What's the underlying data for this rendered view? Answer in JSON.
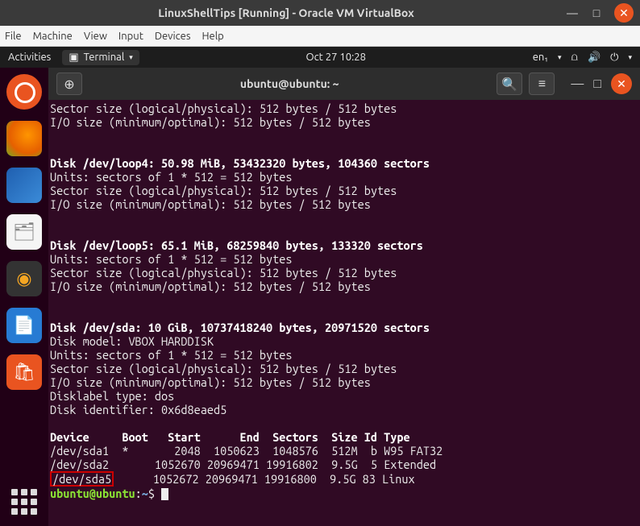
{
  "vbox": {
    "title": "LinuxShellTips [Running] - Oracle VM VirtualBox",
    "menu": {
      "file": "File",
      "machine": "Machine",
      "view": "View",
      "input": "Input",
      "devices": "Devices",
      "help": "Help"
    }
  },
  "gnome": {
    "activities": "Activities",
    "app_label": "Terminal",
    "datetime": "Oct 27  10:28",
    "lang": "en₁"
  },
  "terminal": {
    "title": "ubuntu@ubuntu: ~",
    "prompt_user": "ubuntu@ubuntu",
    "prompt_path": "~",
    "prompt_symbol": "$",
    "intro_lines": [
      "Sector size (logical/physical): 512 bytes / 512 bytes",
      "I/O size (minimum/optimal): 512 bytes / 512 bytes"
    ],
    "loop4": {
      "header": "Disk /dev/loop4: 50.98 MiB, 53432320 bytes, 104360 sectors",
      "lines": [
        "Units: sectors of 1 * 512 = 512 bytes",
        "Sector size (logical/physical): 512 bytes / 512 bytes",
        "I/O size (minimum/optimal): 512 bytes / 512 bytes"
      ]
    },
    "loop5": {
      "header": "Disk /dev/loop5: 65.1 MiB, 68259840 bytes, 133320 sectors",
      "lines": [
        "Units: sectors of 1 * 512 = 512 bytes",
        "Sector size (logical/physical): 512 bytes / 512 bytes",
        "I/O size (minimum/optimal): 512 bytes / 512 bytes"
      ]
    },
    "sda": {
      "header": "Disk /dev/sda: 10 GiB, 10737418240 bytes, 20971520 sectors",
      "lines": [
        "Disk model: VBOX HARDDISK   ",
        "Units: sectors of 1 * 512 = 512 bytes",
        "Sector size (logical/physical): 512 bytes / 512 bytes",
        "I/O size (minimum/optimal): 512 bytes / 512 bytes",
        "Disklabel type: dos",
        "Disk identifier: 0x6d8eaed5"
      ]
    },
    "table": {
      "header": "Device     Boot   Start      End  Sectors  Size Id Type",
      "rows": [
        "/dev/sda1  *       2048  1050623  1048576  512M  b W95 FAT32",
        "/dev/sda2       1052670 20969471 19916802  9.5G  5 Extended"
      ],
      "highlighted_device": "/dev/sda5",
      "highlighted_rest": "      1052672 20969471 19916800  9.5G 83 Linux"
    }
  }
}
